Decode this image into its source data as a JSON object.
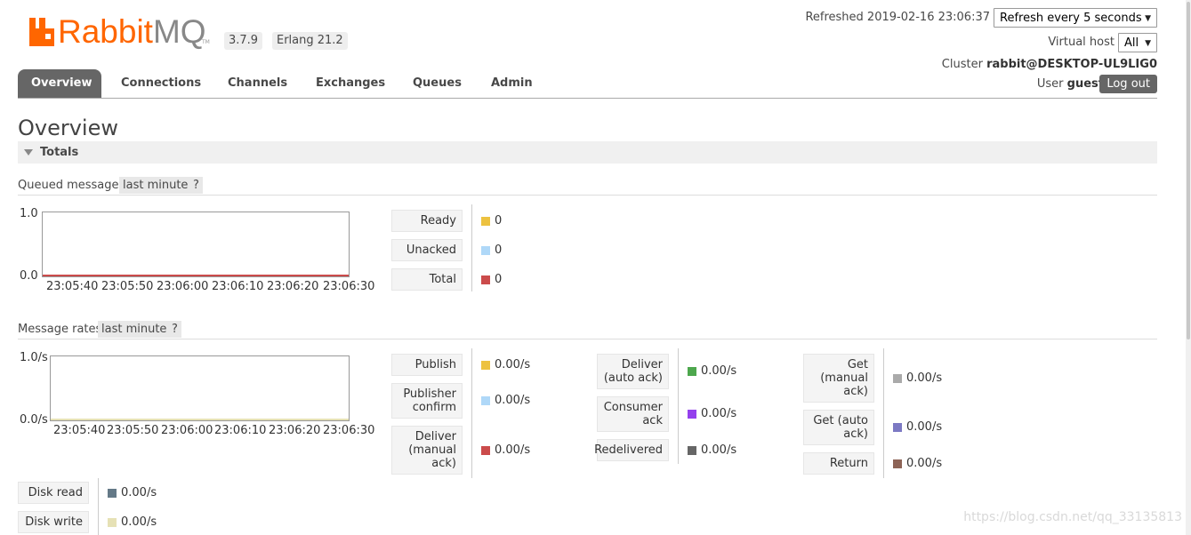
{
  "brand": {
    "logo_text_a": "Rabbit",
    "logo_text_b": "MQ",
    "trademark": "TM",
    "version": "3.7.9",
    "erlang": "Erlang 21.2",
    "accent": "#ff6600"
  },
  "header": {
    "refreshed": "Refreshed 2019-02-16 23:06:37",
    "refresh_select": "Refresh every 5 seconds",
    "vhost_label": "Virtual host",
    "vhost_select": "All",
    "cluster_label": "Cluster",
    "cluster_name": "rabbit@DESKTOP-UL9LIG0",
    "user_label": "User",
    "user_name": "guest",
    "logout": "Log out"
  },
  "tabs": [
    {
      "label": "Overview",
      "active": true
    },
    {
      "label": "Connections"
    },
    {
      "label": "Channels"
    },
    {
      "label": "Exchanges"
    },
    {
      "label": "Queues"
    },
    {
      "label": "Admin"
    }
  ],
  "page_title": "Overview",
  "totals_title": "Totals",
  "queued": {
    "label": "Queued messages",
    "range": "last minute",
    "help": "?",
    "ymax": "1.0",
    "ymin": "0.0",
    "xticks": [
      "23:05:40",
      "23:05:50",
      "23:06:00",
      "23:06:10",
      "23:06:20",
      "23:06:30"
    ],
    "legend": [
      {
        "label": "Ready",
        "value": "0",
        "color": "#edc240"
      },
      {
        "label": "Unacked",
        "value": "0",
        "color": "#afd8f8"
      },
      {
        "label": "Total",
        "value": "0",
        "color": "#cb4b4b"
      }
    ]
  },
  "rates": {
    "label": "Message rates",
    "range": "last minute",
    "help": "?",
    "ymax": "1.0/s",
    "ymin": "0.0/s",
    "xticks": [
      "23:05:40",
      "23:05:50",
      "23:06:00",
      "23:06:10",
      "23:06:20",
      "23:06:30"
    ],
    "col1": [
      {
        "label": "Publish",
        "value": "0.00/s",
        "color": "#edc240"
      },
      {
        "label": "Publisher confirm",
        "value": "0.00/s",
        "color": "#afd8f8"
      },
      {
        "label": "Deliver (manual ack)",
        "value": "0.00/s",
        "color": "#cb4b4b"
      }
    ],
    "col2": [
      {
        "label": "Deliver (auto ack)",
        "value": "0.00/s",
        "color": "#4da74d"
      },
      {
        "label": "Consumer ack",
        "value": "0.00/s",
        "color": "#9440ed"
      },
      {
        "label": "Redelivered",
        "value": "0.00/s",
        "color": "#666666"
      }
    ],
    "col3": [
      {
        "label": "Get (manual ack)",
        "value": "0.00/s",
        "color": "#aaaaaa"
      },
      {
        "label": "Get (auto ack)",
        "value": "0.00/s",
        "color": "#7c79c3"
      },
      {
        "label": "Return",
        "value": "0.00/s",
        "color": "#8d6356"
      }
    ],
    "disk": [
      {
        "label": "Disk read",
        "value": "0.00/s",
        "color": "#647987"
      },
      {
        "label": "Disk write",
        "value": "0.00/s",
        "color": "#e6e1b5"
      }
    ]
  },
  "watermark": "https://blog.csdn.net/qq_33135813"
}
